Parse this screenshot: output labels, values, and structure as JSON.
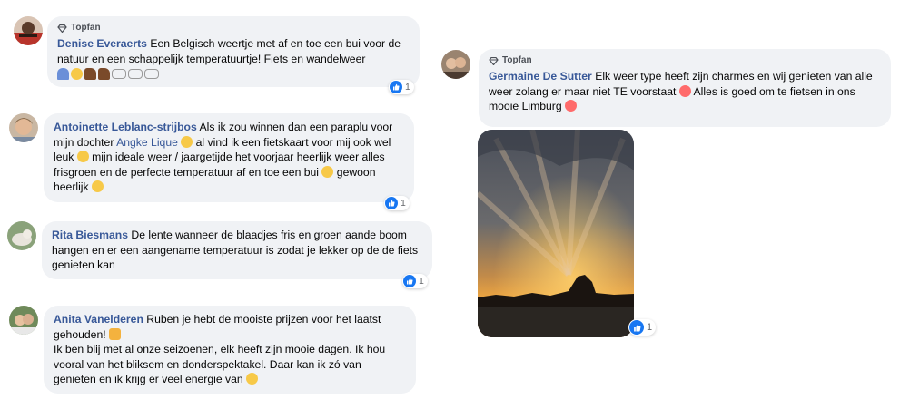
{
  "comments": [
    {
      "badge": "Topfan",
      "name": "Denise Everaerts",
      "text": "Een Belgisch weertje met af en toe een bui voor de natuur en een schappelijk temperatuurtje! Fiets en wandelweer",
      "likes": "1"
    },
    {
      "name": "Antoinette Leblanc-strijbos",
      "text_a": "Als ik zou winnen dan een paraplu voor mijn dochter",
      "mention": "Angke Lique",
      "text_b": "al vind ik een fietskaart voor mij ook wel leuk",
      "text_c": "mijn ideale weer / jaargetijde het voorjaar heerlijk weer alles frisgroen en de perfecte temperatuur af en toe een bui",
      "text_d": "gewoon heerlijk",
      "likes": "1"
    },
    {
      "name": "Rita Biesmans",
      "text": "De lente wanneer de blaadjes fris en groen aande boom hangen en er een aangename temperatuur is zodat je lekker op de de fiets genieten kan",
      "likes": "1"
    },
    {
      "name": "Anita Vanelderen",
      "text_a": "Ruben je hebt de mooiste prijzen voor het laatst gehouden!",
      "text_b": "Ik ben blij met al onze seizoenen, elk heeft zijn mooie dagen. Ik hou vooral van het bliksem en donderspektakel. Daar kan ik zó van genieten en ik krijg er veel energie van"
    },
    {
      "badge": "Topfan",
      "name": "Germaine De Sutter",
      "text_a": "Elk weer type heeft zijn charmes en wij genieten van alle weer zolang er maar niet TE voorstaat",
      "text_b": "Alles is goed om te fietsen in ons mooie Limburg",
      "likes": "1"
    }
  ],
  "colors": {
    "bubble": "#f0f2f5",
    "name": "#385898",
    "like": "#1877f2"
  }
}
